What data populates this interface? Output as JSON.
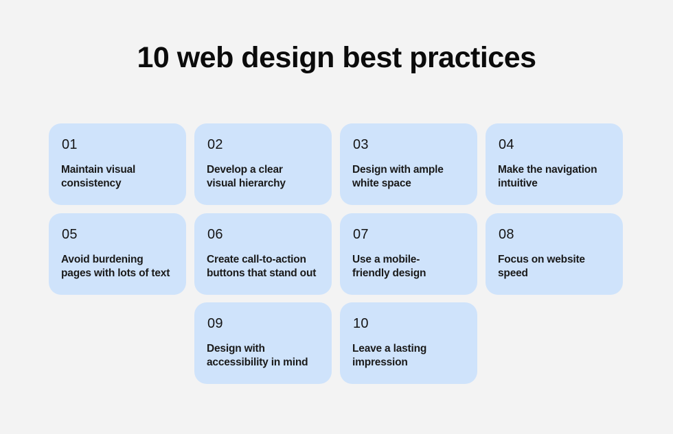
{
  "title": "10 web design best practices",
  "colors": {
    "background": "#f3f3f3",
    "card": "#cfe3fb",
    "text": "#111111"
  },
  "practices": [
    {
      "number": "01",
      "text_line1": "Maintain visual",
      "text_line2": "consistency"
    },
    {
      "number": "02",
      "text_line1": "Develop a clear",
      "text_line2": "visual hierarchy"
    },
    {
      "number": "03",
      "text_line1": "Design with ample",
      "text_line2": "white space"
    },
    {
      "number": "04",
      "text_line1": "Make the navigation",
      "text_line2": "intuitive"
    },
    {
      "number": "05",
      "text_line1": "Avoid burdening",
      "text_line2": "pages with lots of text"
    },
    {
      "number": "06",
      "text_line1": "Create call-to-action",
      "text_line2": "buttons that stand out"
    },
    {
      "number": "07",
      "text_line1": "Use a mobile-",
      "text_line2": "friendly design"
    },
    {
      "number": "08",
      "text_line1": "Focus on website",
      "text_line2": "speed"
    },
    {
      "number": "09",
      "text_line1": "Design with",
      "text_line2": "accessibility in mind"
    },
    {
      "number": "10",
      "text_line1": "Leave a lasting",
      "text_line2": "impression"
    }
  ]
}
